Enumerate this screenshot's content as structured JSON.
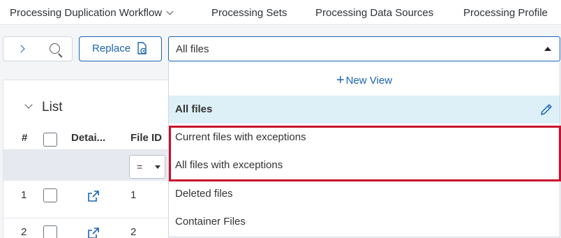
{
  "nav": {
    "tabs": [
      {
        "label": "Processing Duplication Workflow"
      },
      {
        "label": "Processing Sets"
      },
      {
        "label": "Processing Data Sources"
      },
      {
        "label": "Processing Profile"
      }
    ]
  },
  "toolbar": {
    "replace_label": "Replace"
  },
  "list": {
    "title": "List",
    "columns": [
      "#",
      "Detai...",
      "File ID"
    ],
    "filter_operator": "=",
    "rows": [
      {
        "num": "1",
        "file_id": "1"
      },
      {
        "num": "2",
        "file_id": "2"
      }
    ]
  },
  "view_dropdown": {
    "value": "All files",
    "new_view_label": "New View",
    "options": [
      {
        "label": "All files",
        "selected": true
      },
      {
        "label": "Current files with exceptions"
      },
      {
        "label": "All files with exceptions"
      },
      {
        "label": "Deleted files"
      },
      {
        "label": "Container Files"
      }
    ]
  },
  "colors": {
    "accent": "#1b64b4",
    "selected_bg": "#ddeff7",
    "highlight": "#c8102e"
  }
}
